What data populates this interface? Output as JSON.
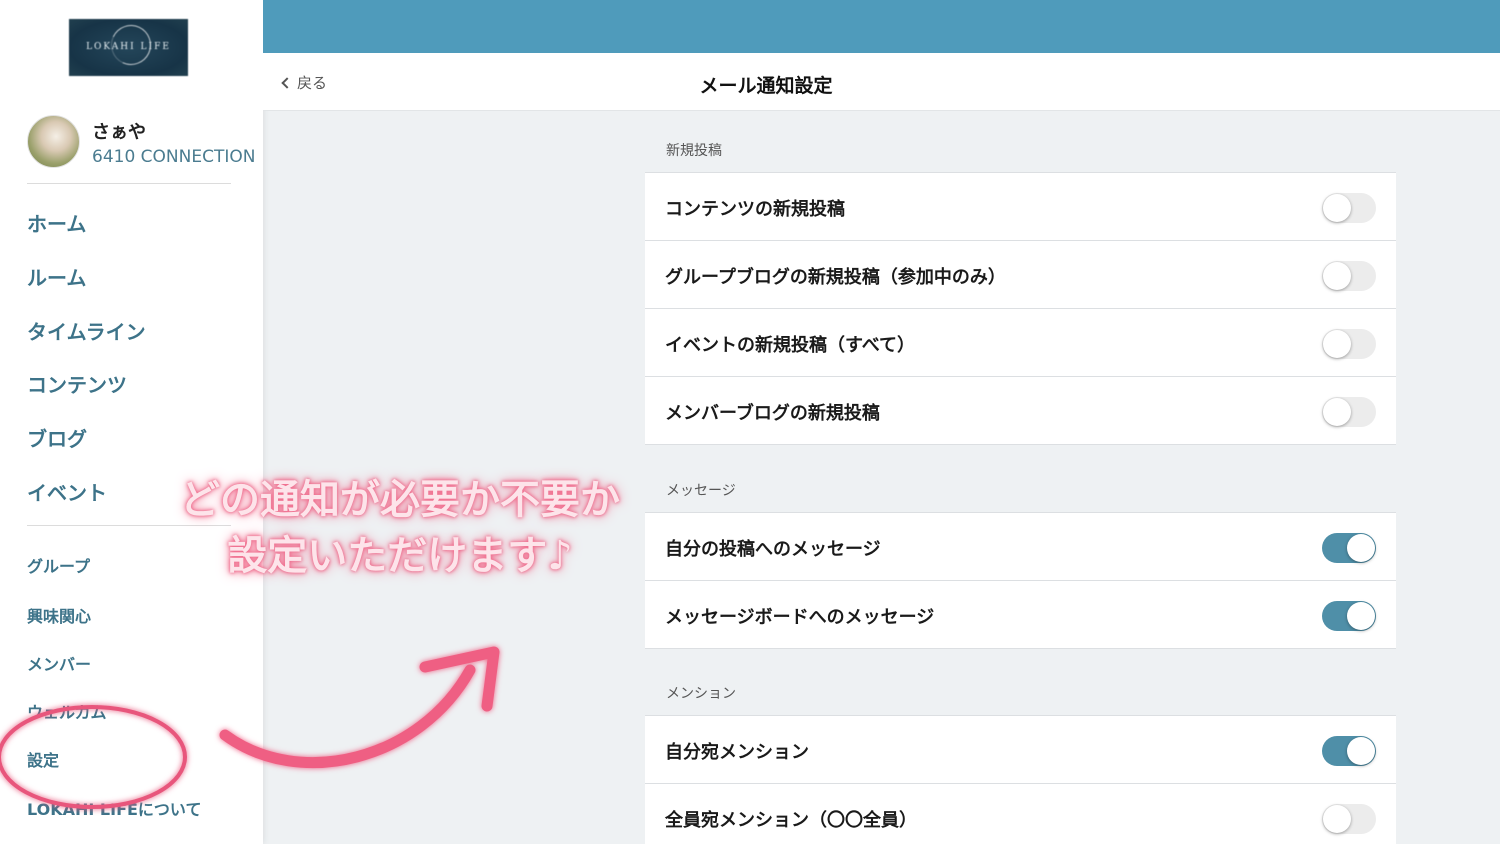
{
  "sidebar": {
    "logo_text": "LOKAHI LIFE",
    "user": {
      "name": "さぁや",
      "connection": "6410 CONNECTION"
    },
    "nav_primary": [
      "ホーム",
      "ルーム",
      "タイムライン",
      "コンテンツ",
      "ブログ",
      "イベント"
    ],
    "nav_secondary": [
      "グループ",
      "興味関心",
      "メンバー",
      "ウェルカム",
      "設定",
      "LOKAHI LIFEについて"
    ]
  },
  "header": {
    "back_label": "戻る",
    "title": "メール通知設定"
  },
  "sections": [
    {
      "label": "新規投稿",
      "rows": [
        {
          "label": "コンテンツの新規投稿",
          "enabled": false
        },
        {
          "label": "グループブログの新規投稿（参加中のみ）",
          "enabled": false
        },
        {
          "label": "イベントの新規投稿（すべて）",
          "enabled": false
        },
        {
          "label": "メンバーブログの新規投稿",
          "enabled": false
        }
      ]
    },
    {
      "label": "メッセージ",
      "rows": [
        {
          "label": "自分の投稿へのメッセージ",
          "enabled": true
        },
        {
          "label": "メッセージボードへのメッセージ",
          "enabled": true
        }
      ]
    },
    {
      "label": "メンション",
      "rows": [
        {
          "label": "自分宛メンション",
          "enabled": true
        },
        {
          "label": "全員宛メンション（〇〇全員）",
          "enabled": false
        }
      ]
    }
  ],
  "annotation": {
    "line1": "どの通知が必要か不要か",
    "line2": "設定いただけます♪"
  },
  "colors": {
    "accent": "#4f9bbb",
    "toggle_on": "#4f8fa8",
    "nav_text": "#3d7389",
    "annotation": "#f06d8e"
  }
}
